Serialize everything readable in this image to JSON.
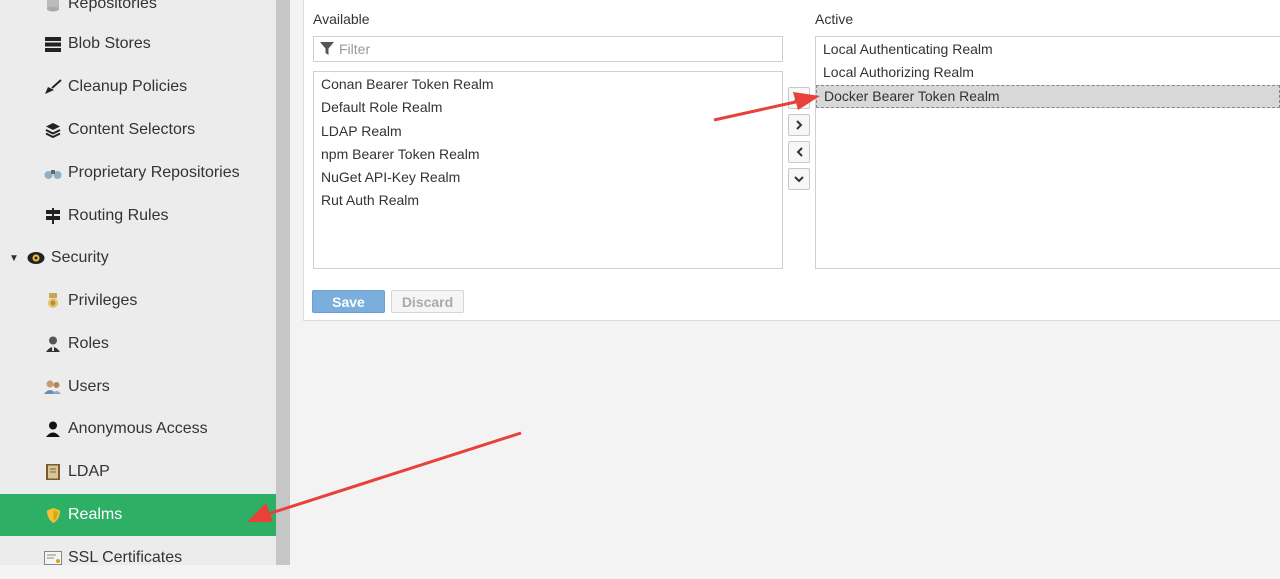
{
  "sidebar": {
    "items": [
      {
        "label": "Repositories",
        "icon": "database-icon"
      },
      {
        "label": "Blob Stores",
        "icon": "server-icon"
      },
      {
        "label": "Cleanup Policies",
        "icon": "broom-icon"
      },
      {
        "label": "Content Selectors",
        "icon": "layers-icon"
      },
      {
        "label": "Proprietary Repositories",
        "icon": "binoculars-icon"
      },
      {
        "label": "Routing Rules",
        "icon": "signpost-icon"
      },
      {
        "label": "Security",
        "icon": "eye-icon"
      },
      {
        "label": "Privileges",
        "icon": "medal-icon"
      },
      {
        "label": "Roles",
        "icon": "user-tie-icon"
      },
      {
        "label": "Users",
        "icon": "users-icon"
      },
      {
        "label": "Anonymous Access",
        "icon": "user-icon"
      },
      {
        "label": "LDAP",
        "icon": "book-icon"
      },
      {
        "label": "Realms",
        "icon": "shield-icon"
      },
      {
        "label": "SSL Certificates",
        "icon": "certificate-icon"
      }
    ],
    "active_color": "#2eaf66"
  },
  "realms": {
    "available_label": "Available",
    "active_label": "Active",
    "filter_placeholder": "Filter",
    "available": [
      "Conan Bearer Token Realm",
      "Default Role Realm",
      "LDAP Realm",
      "npm Bearer Token Realm",
      "NuGet API-Key Realm",
      "Rut Auth Realm"
    ],
    "active": [
      "Local Authenticating Realm",
      "Local Authorizing Realm",
      "Docker Bearer Token Realm"
    ],
    "selected_active": "Docker Bearer Token Realm",
    "save_label": "Save",
    "discard_label": "Discard"
  },
  "colors": {
    "annotation_arrow": "#e8413a",
    "save_button": "#7aaedc"
  }
}
